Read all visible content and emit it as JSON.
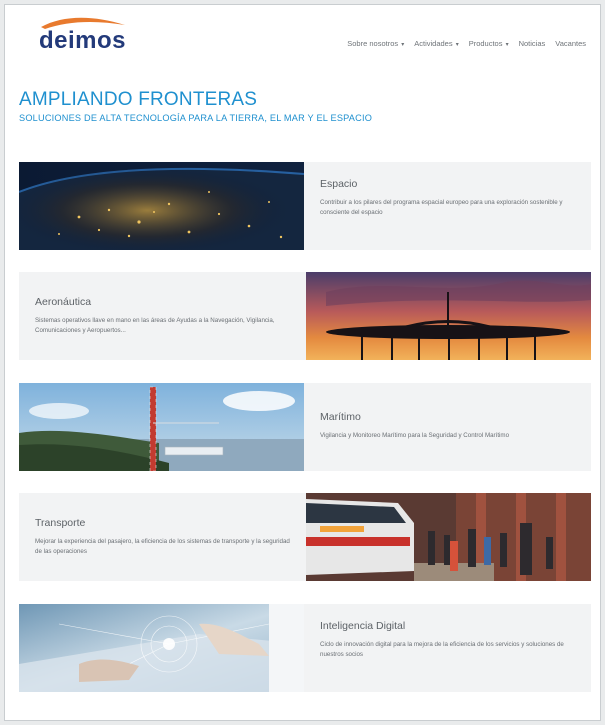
{
  "header": {
    "logo_text": "deimos",
    "nav": [
      {
        "label": "Sobre nosotros",
        "caret": "▾"
      },
      {
        "label": "Actividades",
        "caret": "▾"
      },
      {
        "label": "Productos",
        "caret": "▾"
      },
      {
        "label": "Noticias",
        "caret": ""
      },
      {
        "label": "Vacantes",
        "caret": ""
      }
    ]
  },
  "hero": {
    "title": "AMPLIANDO FRONTERAS",
    "subtitle": "SOLUCIONES DE ALTA TECNOLOGÍA PARA LA TIERRA, EL MAR Y EL ESPACIO"
  },
  "colors": {
    "accent": "#1f90cf",
    "brand": "#233a7a",
    "logo_swoosh": "#e87a2e",
    "card_bg": "#f2f3f4"
  },
  "cards": [
    {
      "title": "Espacio",
      "text": "Contribuir a los pilares del programa espacial europeo para una exploración sostenible y consciente del espacio",
      "image": "earth-night-image"
    },
    {
      "title": "Aeronáutica",
      "text": "Sistemas operativos llave en mano en las áreas de Ayudas a la Navegación, Vigilancia, Comunicaciones y Aeropuertos...",
      "image": "radar-sunset-image"
    },
    {
      "title": "Marítimo",
      "text": "Vigilancia y Monitoreo Marítimo para la Seguridad y Control Marítimo",
      "image": "coastal-tower-image"
    },
    {
      "title": "Transporte",
      "text": "Mejorar la experiencia del pasajero, la eficiencia de los sistemas de transporte y la seguridad de las operaciones",
      "image": "train-platform-image"
    },
    {
      "title": "Inteligencia Digital",
      "text": "Ciclo de innovación digital para la mejora de la eficiencia de los servicios y soluciones de nuestros socios",
      "image": "digital-hands-image"
    }
  ]
}
